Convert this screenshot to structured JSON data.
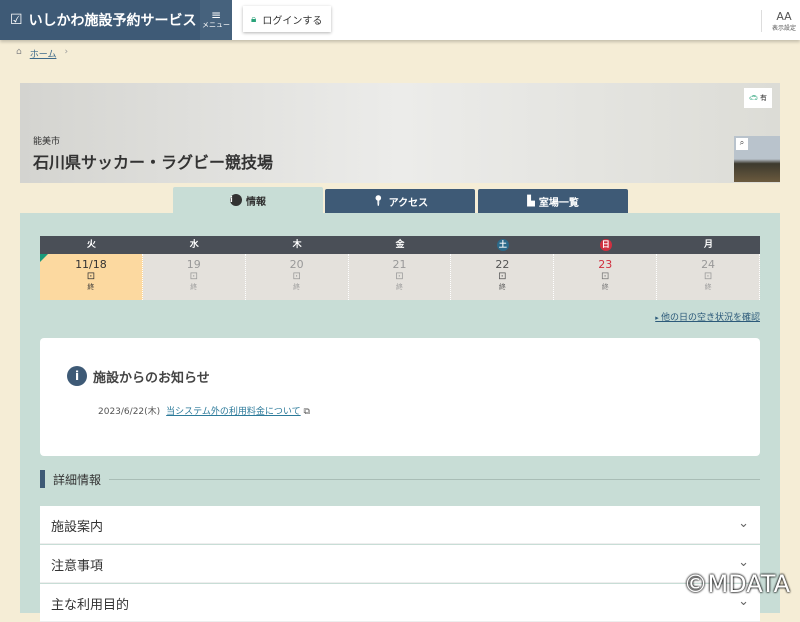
{
  "header": {
    "title": "いしかわ施設予約サービス",
    "menu": "メニュー",
    "login": "ログインする",
    "display_settings": "表示設定",
    "aa": "AA"
  },
  "breadcrumb": {
    "home": "ホーム",
    "sep": "›"
  },
  "facility": {
    "city": "能美市",
    "name": "石川県サッカー・ラグビー競技場",
    "parking": "有"
  },
  "tabs": [
    "情報",
    "アクセス",
    "室場一覧"
  ],
  "calendar": {
    "days": [
      {
        "dow": "火",
        "date": "11/18",
        "status": "終"
      },
      {
        "dow": "水",
        "date": "19",
        "status": "終"
      },
      {
        "dow": "木",
        "date": "20",
        "status": "終"
      },
      {
        "dow": "金",
        "date": "21",
        "status": "終"
      },
      {
        "dow": "土",
        "date": "22",
        "status": "終"
      },
      {
        "dow": "日",
        "date": "23",
        "status": "終"
      },
      {
        "dow": "月",
        "date": "24",
        "status": "終"
      }
    ],
    "more": "他の日の空き状況を確認"
  },
  "notice": {
    "title": "施設からのお知らせ",
    "date": "2023/6/22(木)",
    "link": "当システム外の利用料金について"
  },
  "details": {
    "title": "詳細情報",
    "items": [
      "施設案内",
      "注意事項",
      "主な利用目的"
    ]
  },
  "watermark": "©MDATA"
}
